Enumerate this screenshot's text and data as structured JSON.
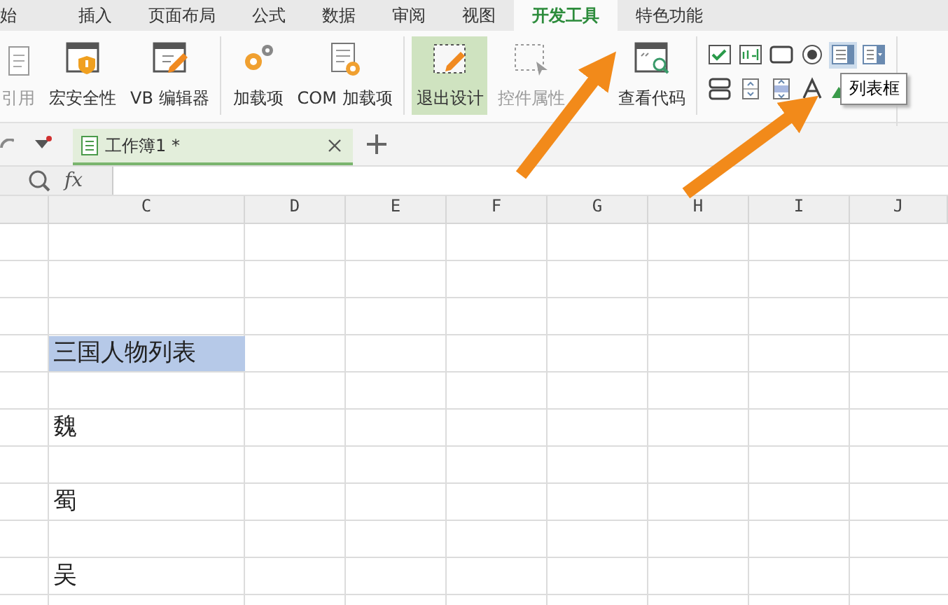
{
  "ribbon_tabs": [
    {
      "label": "始",
      "selected": false
    },
    {
      "label": "插入",
      "selected": false
    },
    {
      "label": "页面布局",
      "selected": false
    },
    {
      "label": "公式",
      "selected": false
    },
    {
      "label": "数据",
      "selected": false
    },
    {
      "label": "审阅",
      "selected": false
    },
    {
      "label": "视图",
      "selected": false
    },
    {
      "label": "开发工具",
      "selected": true
    },
    {
      "label": "特色功能",
      "selected": false
    }
  ],
  "ribbon_groups": [
    {
      "buttons": [
        {
          "kind": "reference",
          "label": "引用",
          "selected": false,
          "disabled": true
        },
        {
          "kind": "macro-security",
          "label": "宏安全性",
          "selected": false,
          "disabled": false
        },
        {
          "kind": "vb-editor",
          "label": "VB 编辑器",
          "selected": false,
          "disabled": false
        }
      ]
    },
    {
      "buttons": [
        {
          "kind": "addin",
          "label": "加载项",
          "selected": false,
          "disabled": false
        },
        {
          "kind": "com-addin",
          "label": "COM 加载项",
          "selected": false,
          "disabled": false
        }
      ]
    },
    {
      "buttons": [
        {
          "kind": "design-mode",
          "label": "退出设计",
          "selected": true,
          "disabled": false
        },
        {
          "kind": "properties",
          "label": "控件属性",
          "selected": false,
          "disabled": true
        },
        {
          "kind": "view-code",
          "label": "查看代码",
          "selected": false,
          "disabled": false
        }
      ]
    }
  ],
  "form_controls": [
    [
      {
        "kind": "checkbox",
        "selected": false
      },
      {
        "kind": "textbox",
        "selected": false
      },
      {
        "kind": "button",
        "selected": false
      },
      {
        "kind": "radio",
        "selected": false
      },
      {
        "kind": "listbox",
        "selected": true
      },
      {
        "kind": "combobox",
        "selected": false
      }
    ],
    [
      {
        "kind": "toggle",
        "selected": false
      },
      {
        "kind": "spin",
        "selected": false
      },
      {
        "kind": "scrollbar",
        "selected": false
      },
      {
        "kind": "label",
        "selected": false
      },
      {
        "kind": "image",
        "selected": false
      }
    ]
  ],
  "tooltip": {
    "text": "列表框"
  },
  "document_tabs": [
    {
      "title": "工作簿1 *",
      "selected": true
    }
  ],
  "formula_bar": {
    "function_label": "fx"
  },
  "sheet": {
    "columns": [
      "C",
      "D",
      "E",
      "F",
      "G",
      "H",
      "I",
      "J"
    ],
    "rows": [
      {
        "selected": false
      },
      {
        "selected": false
      },
      {
        "selected": false
      },
      {
        "column_c": "三国人物列表",
        "selected": true
      },
      {
        "selected": false
      },
      {
        "column_c": "魏",
        "selected": false
      },
      {
        "selected": false
      },
      {
        "column_c": "蜀",
        "selected": false
      },
      {
        "selected": false
      },
      {
        "column_c": "吴",
        "selected": false
      },
      {
        "selected": false
      }
    ]
  }
}
